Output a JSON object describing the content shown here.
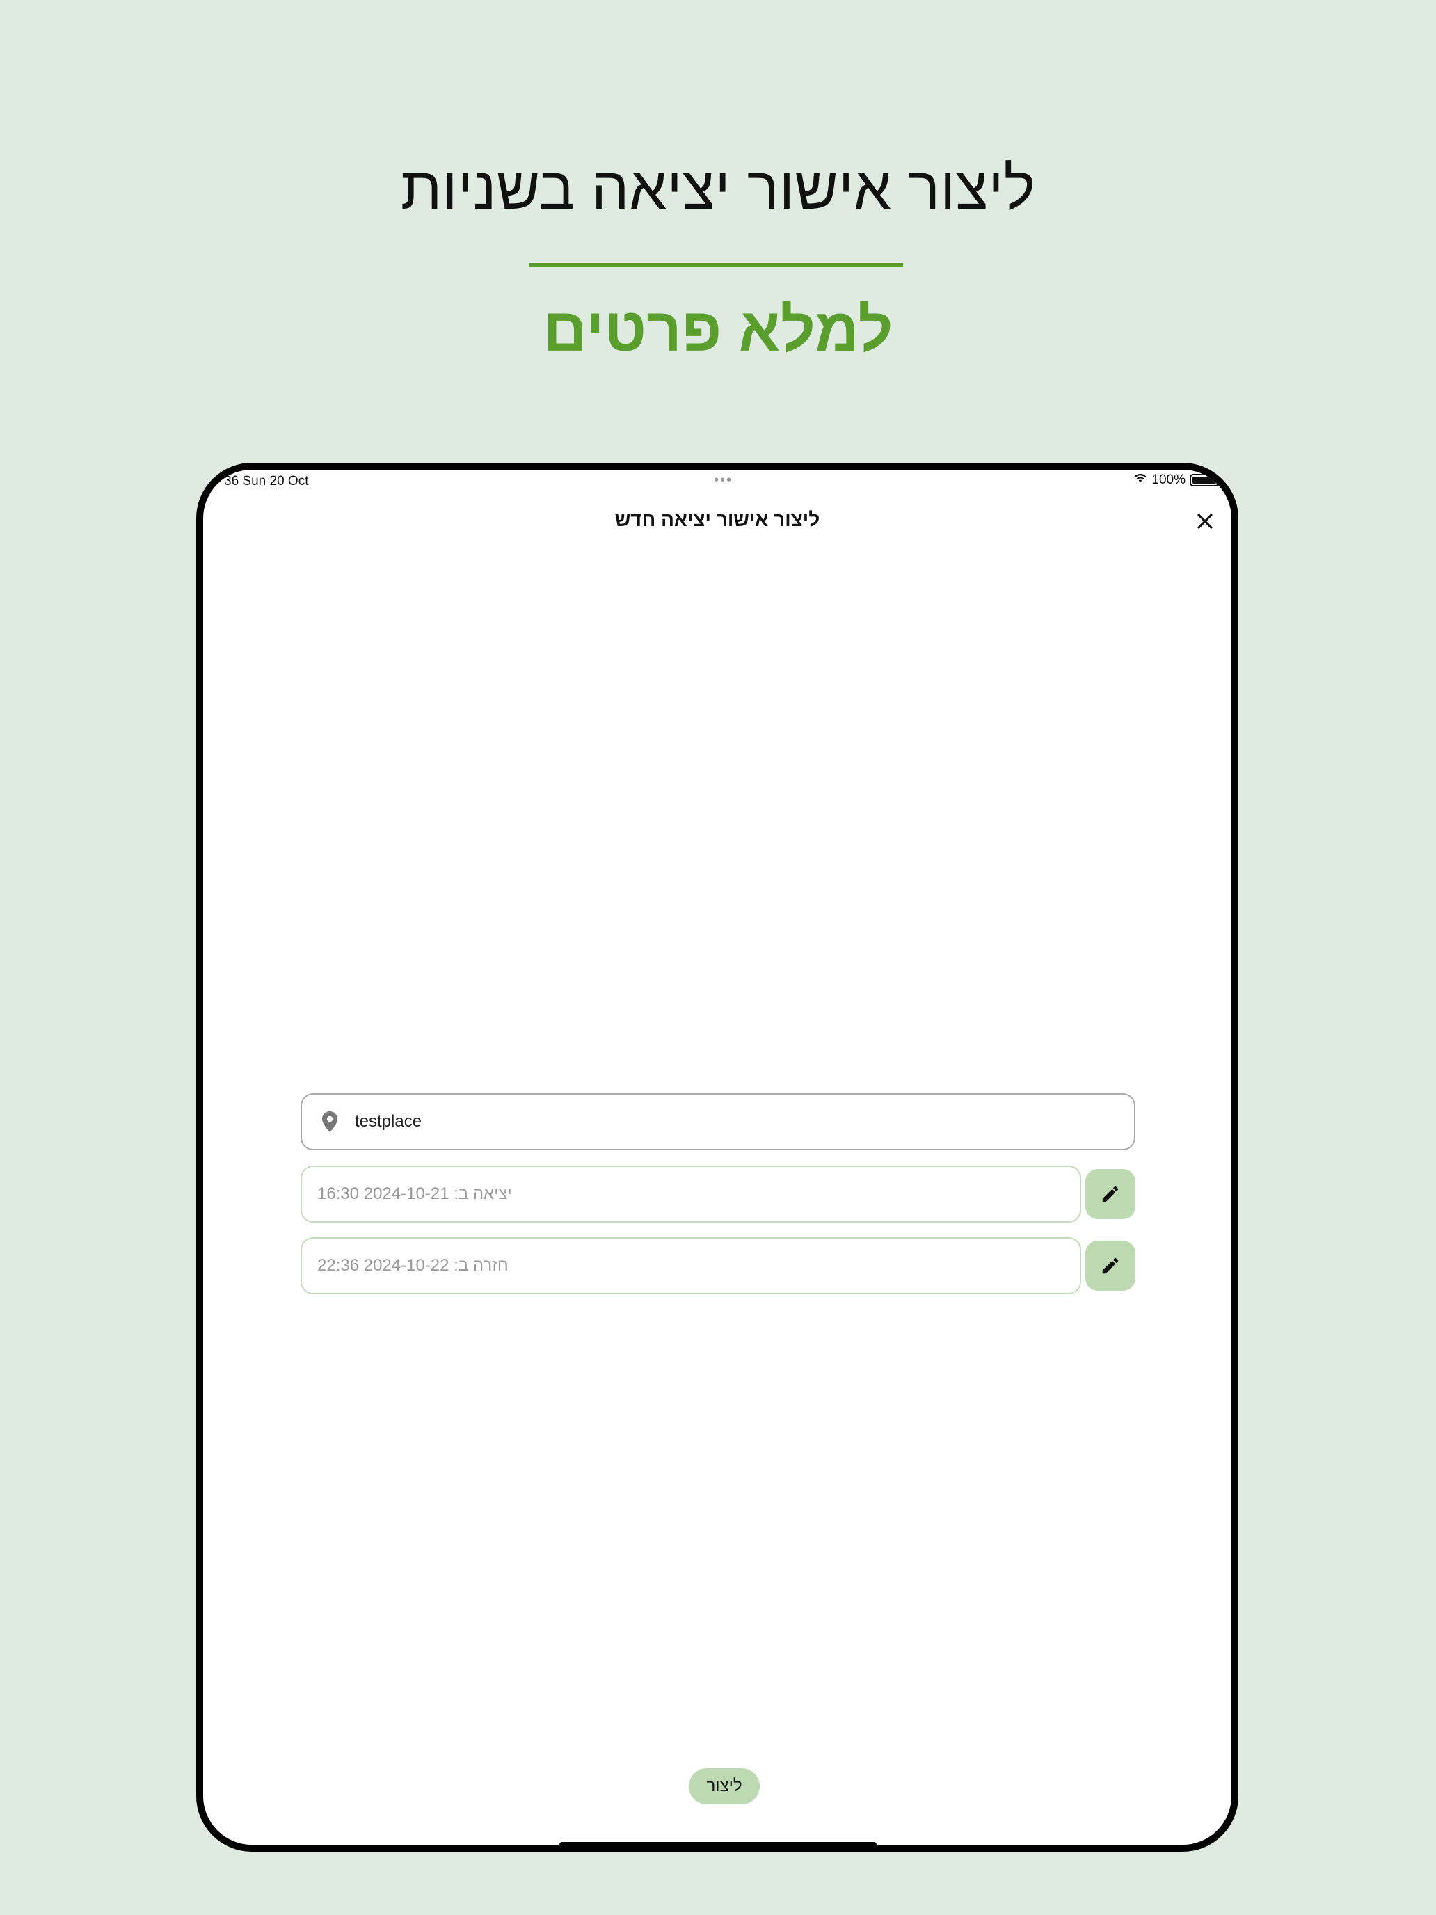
{
  "promo": {
    "headline": "ליצור אישור יציאה בשניות",
    "subheadline": "למלא פרטים",
    "accent_color": "#5a9e2d",
    "background_color": "#dfeae1"
  },
  "status_bar": {
    "time_date": "36   Sun 20 Oct",
    "dots": "•••",
    "battery": "100%",
    "wifi_icon": "wifi-icon"
  },
  "sheet": {
    "title": "ליצור אישור יציאה חדש",
    "close_icon": "close-icon"
  },
  "form": {
    "location": {
      "icon": "location-pin-icon",
      "value": "testplace"
    },
    "exit": {
      "value": "16:30 2024-10-21 :יציאה ב",
      "edit_icon": "pencil-icon"
    },
    "return": {
      "value": "22:36 2024-10-22 :חזרה ב",
      "edit_icon": "pencil-icon"
    },
    "button_color": "#bcd9b1"
  },
  "actions": {
    "create_label": "ליצור"
  }
}
